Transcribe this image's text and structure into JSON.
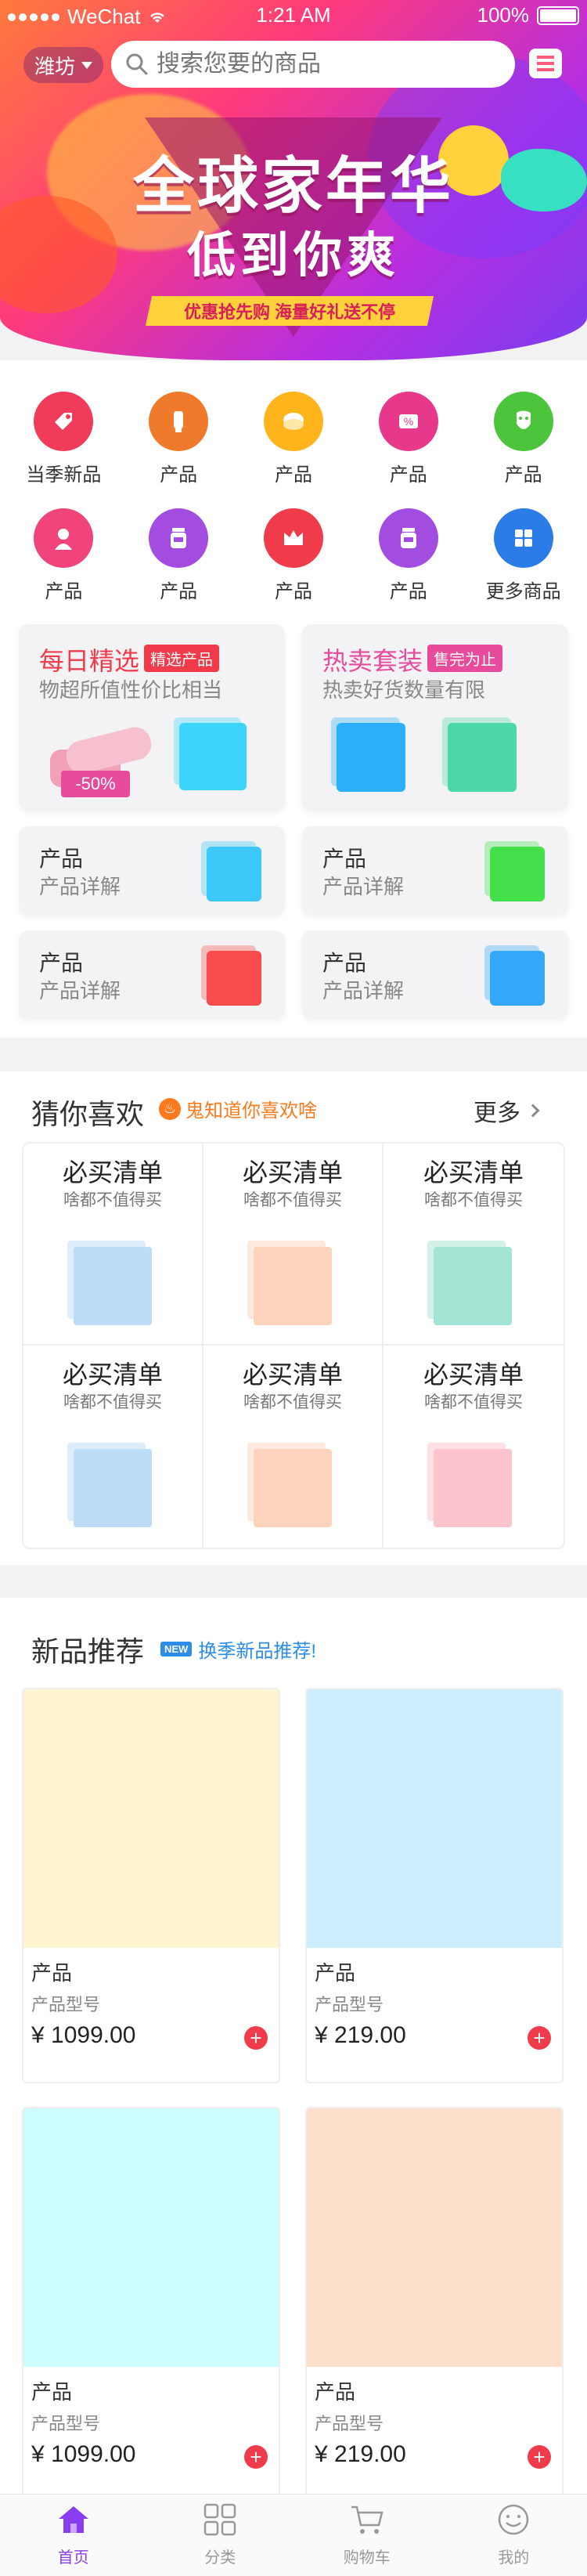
{
  "status_bar": {
    "carrier": "WeChat",
    "time": "1:21 AM",
    "battery": "100%"
  },
  "header": {
    "city": "潍坊",
    "search_placeholder": "搜索您要的商品"
  },
  "banner": {
    "title_line1": "全球家年华",
    "title_line2": "低到你爽",
    "ribbon": "优惠抢先购  海量好礼送不停"
  },
  "categories": [
    {
      "label": "当季新品",
      "color": "#f03c5a",
      "icon": "tag-icon"
    },
    {
      "label": "产品",
      "color": "#f07a2c",
      "icon": "cosmetic-tube-icon"
    },
    {
      "label": "产品",
      "color": "#ffb41c",
      "icon": "compact-icon"
    },
    {
      "label": "产品",
      "color": "#e8388c",
      "icon": "percent-tag-icon"
    },
    {
      "label": "产品",
      "color": "#4cc43c",
      "icon": "face-mask-icon"
    },
    {
      "label": "产品",
      "color": "#f0447a",
      "icon": "woman-icon"
    },
    {
      "label": "产品",
      "color": "#a24ce0",
      "icon": "jar-icon"
    },
    {
      "label": "产品",
      "color": "#f03c4a",
      "icon": "crown-icon"
    },
    {
      "label": "产品",
      "color": "#a24ce0",
      "icon": "jar-icon"
    },
    {
      "label": "更多商品",
      "color": "#2c7ce8",
      "icon": "grid-icon"
    }
  ],
  "promos": {
    "daily": {
      "title": "每日精选",
      "tag": "精选产品",
      "subtitle": "物超所值性价比相当",
      "discount": "-50%",
      "title_color": "#f03c4a"
    },
    "hot": {
      "title": "热卖套装",
      "tag": "售完为止",
      "subtitle": "热卖好货数量有限",
      "title_color": "#e84a9c"
    },
    "small_cards": [
      {
        "title": "产品",
        "subtitle": "产品详解",
        "color": "#3cc8f8"
      },
      {
        "title": "产品",
        "subtitle": "产品详解",
        "color": "#44e04c"
      },
      {
        "title": "产品",
        "subtitle": "产品详解",
        "color": "#f84c4c"
      },
      {
        "title": "产品",
        "subtitle": "产品详解",
        "color": "#34a8f8"
      }
    ]
  },
  "guess": {
    "title": "猜你喜欢",
    "subtitle": "鬼知道你喜欢啥",
    "more": "更多",
    "items": [
      {
        "title": "必买清单",
        "subtitle": "啥都不值得买",
        "color": "#bcdcf8"
      },
      {
        "title": "必买清单",
        "subtitle": "啥都不值得买",
        "color": "#fcd4bc"
      },
      {
        "title": "必买清单",
        "subtitle": "啥都不值得买",
        "color": "#a4e4d4"
      },
      {
        "title": "必买清单",
        "subtitle": "啥都不值得买",
        "color": "#bcdcf8"
      },
      {
        "title": "必买清单",
        "subtitle": "啥都不值得买",
        "color": "#fcd4bc"
      },
      {
        "title": "必买清单",
        "subtitle": "啥都不值得买",
        "color": "#fcc4cc"
      }
    ]
  },
  "new_products": {
    "title": "新品推荐",
    "badge": "NEW",
    "subtitle": "换季新品推荐!",
    "items": [
      {
        "name": "产品",
        "model": "产品型号",
        "price": "¥ 1099.00",
        "color": "#fff4d0"
      },
      {
        "name": "产品",
        "model": "产品型号",
        "price": "¥ 219.00",
        "color": "#cceefc"
      },
      {
        "name": "产品",
        "model": "产品型号",
        "price": "¥ 1099.00",
        "color": "#ccfcfc"
      },
      {
        "name": "产品",
        "model": "产品型号",
        "price": "¥ 219.00",
        "color": "#fde0cc"
      }
    ]
  },
  "tabbar": [
    {
      "label": "首页",
      "icon": "home-icon",
      "active": true
    },
    {
      "label": "分类",
      "icon": "category-grid-icon",
      "active": false
    },
    {
      "label": "购物车",
      "icon": "cart-icon",
      "active": false
    },
    {
      "label": "我的",
      "icon": "profile-icon",
      "active": false
    }
  ]
}
